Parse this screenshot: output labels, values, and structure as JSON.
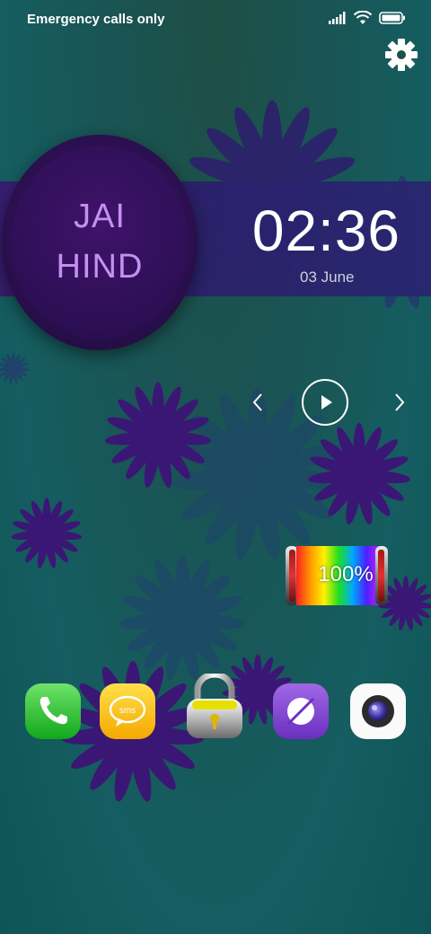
{
  "status_bar": {
    "carrier_text": "Emergency calls only",
    "icons": [
      "signal-icon",
      "wifi-icon",
      "battery-icon"
    ]
  },
  "settings": {
    "icon": "gear-icon"
  },
  "widget": {
    "line1": "JAI",
    "line2": "HIND",
    "time": "02:36",
    "date": "03 June"
  },
  "media": {
    "prev": "chevron-left-icon",
    "play": "play-icon",
    "next": "chevron-right-icon"
  },
  "battery_widget": {
    "text": "100%",
    "level": 1.0
  },
  "dock": {
    "apps": [
      {
        "name": "phone",
        "icon": "phone-icon"
      },
      {
        "name": "sms",
        "label": "sms",
        "icon": "sms-icon"
      },
      {
        "name": "lock",
        "icon": "padlock-icon"
      },
      {
        "name": "browser",
        "icon": "browser-icon"
      },
      {
        "name": "camera",
        "icon": "camera-icon"
      }
    ]
  },
  "colors": {
    "accent_purple": "#c490f0",
    "band": "#2c1f6b",
    "flower": "#3a1775"
  }
}
